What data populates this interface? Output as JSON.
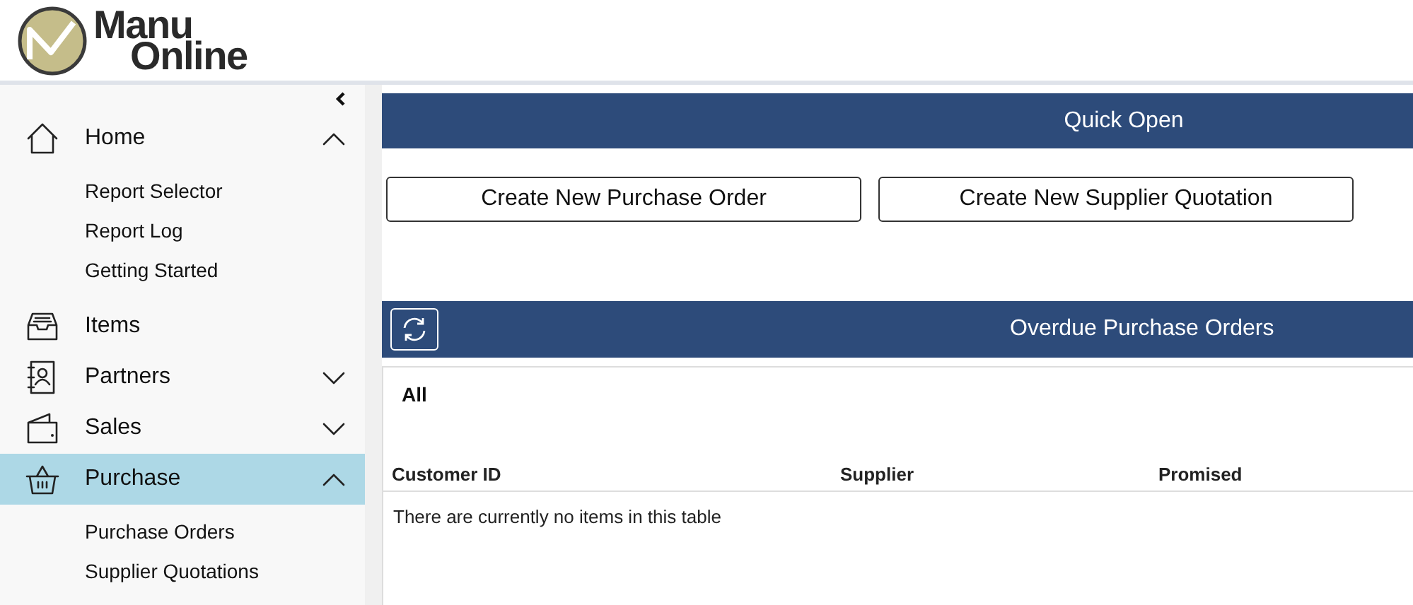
{
  "logo": {
    "line_1": "Manu",
    "line_2": "Online"
  },
  "sidebar": {
    "items": [
      {
        "label": "Home",
        "kind": "group",
        "expanded": true,
        "selected": false,
        "children": [
          {
            "label": "Report Selector"
          },
          {
            "label": "Report Log"
          },
          {
            "label": "Getting Started"
          }
        ]
      },
      {
        "label": "Items",
        "kind": "link",
        "selected": false
      },
      {
        "label": "Partners",
        "kind": "group",
        "expanded": false,
        "selected": false
      },
      {
        "label": "Sales",
        "kind": "group",
        "expanded": false,
        "selected": false
      },
      {
        "label": "Purchase",
        "kind": "group",
        "expanded": true,
        "selected": true,
        "children": [
          {
            "label": "Purchase Orders"
          },
          {
            "label": "Supplier Quotations"
          }
        ]
      }
    ]
  },
  "quick_open": {
    "title": "Quick Open",
    "buttons": [
      "Create New Purchase Order",
      "Create New Supplier Quotation"
    ]
  },
  "overdue": {
    "title": "Overdue Purchase Orders",
    "filter": "All",
    "columns": [
      "Customer ID",
      "Supplier",
      "Promised"
    ],
    "empty_message": "There are currently no items in this table"
  }
}
